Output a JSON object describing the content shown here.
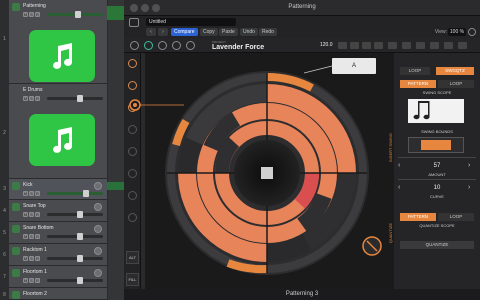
{
  "window": {
    "title": "Patterning",
    "footer": "Patterning 3"
  },
  "host": {
    "preset": "Untitled",
    "compare": "Compare",
    "copy": "Copy",
    "paste": "Paste",
    "undo": "Undo",
    "redo": "Redo",
    "view_label": "View:",
    "zoom": "100 %"
  },
  "toolbar": {
    "project_label": "PROJECT",
    "project_name": "Lavender Force",
    "tempo": "120.0"
  },
  "tracks": [
    {
      "num": "1",
      "name": "Patterning"
    },
    {
      "num": "2",
      "name": "E Drums"
    },
    {
      "num": "3",
      "name": "Kick"
    },
    {
      "num": "4",
      "name": "Snare Top"
    },
    {
      "num": "5",
      "name": "Snare Bottom"
    },
    {
      "num": "6",
      "name": "Racktom 1"
    },
    {
      "num": "7",
      "name": "Floortom 1"
    },
    {
      "num": "8",
      "name": "Floortom 2"
    }
  ],
  "msr": {
    "m": "M",
    "s": "S",
    "r": "R"
  },
  "left_buttons": {
    "alt": "ALT",
    "fill": "FILL"
  },
  "step_button": "A",
  "right_panel": {
    "tabs_top": [
      "LOOP",
      "SWGQTZ"
    ],
    "tab_pattern": "PATTERN",
    "tab_loop": "LOOP",
    "swing_scope": "SWING SCOPE",
    "swing_bounds": "SWING BOUNDS",
    "amount_value": "57",
    "amount_label": "AMOUNT",
    "curve_value": "10",
    "curve_label": "CURVE",
    "quantize_scope": "QUANTIZE SCOPE",
    "quantize": "QUANTIZE",
    "side_swing": "INSERT SWING",
    "side_quantize": "QUANTIZE"
  },
  "colors": {
    "accent": "#e7873f",
    "ring": "#e8845a",
    "plugin_bg": "#1a1a1a",
    "art_green": "#2fc646"
  }
}
